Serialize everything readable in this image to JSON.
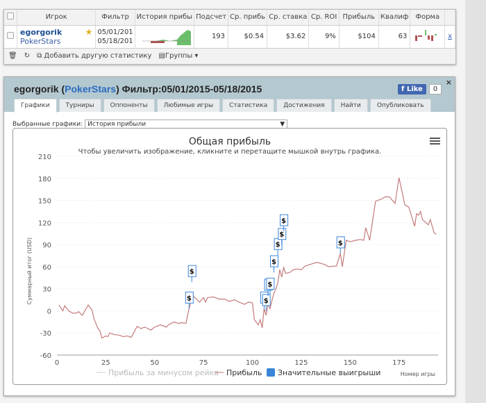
{
  "table": {
    "headers": [
      "Игрок",
      "Фильтр",
      "История прибы",
      "Подсчет",
      "Ср. прибь",
      "Ср. ставка",
      "Ср. ROI",
      "Прибыль",
      "Квалиф",
      "Форма"
    ],
    "row": {
      "player": "egorgorik",
      "site": "PokerStars",
      "filter_from": "05/01/201",
      "filter_to": "05/18/201",
      "count": "193",
      "avg_profit": "$0.54",
      "avg_stake": "$3.62",
      "avg_roi": "9%",
      "profit": "$104",
      "qual": "63",
      "remove": "x"
    },
    "footer": {
      "add_stat": "Добавить другую статистику",
      "groups": "Группы"
    }
  },
  "panel": {
    "player": "egorgorik",
    "site": "PokerStars",
    "filter": "Фильтр:05/01/2015-05/18/2015",
    "like": "Like",
    "like_count": "0",
    "close": "×",
    "tabs": [
      "Графики",
      "Турниры",
      "Оппоненты",
      "Любимые игры",
      "Статистика",
      "Достижения",
      "Найти",
      "Опубликовать"
    ],
    "active_tab": 0,
    "select_label": "Выбранные графики:",
    "select_value": "История прибыли"
  },
  "chart_data": {
    "type": "line",
    "title": "Общая прибыль",
    "subtitle": "Чтобы увеличить изображение, кликните и перетащите мышкой внутрь графика.",
    "ylabel": "Суммарный итог (USD)",
    "xlabel": "Номер игры",
    "ylim": [
      -60,
      210
    ],
    "yticks": [
      -60,
      -30,
      0,
      30,
      60,
      90,
      120,
      150,
      180,
      210
    ],
    "xlim": [
      0,
      195
    ],
    "xticks": [
      0,
      25,
      50,
      75,
      100,
      125,
      150,
      175
    ],
    "grid": true,
    "legend_placement": "bottom",
    "legend": [
      "Прибыль за минусом рейка",
      "Прибыль",
      "Значительные выигрыши"
    ],
    "colors": {
      "profit": "#c47a7a",
      "rake": "#cccccc",
      "flags": "#3a85d8"
    },
    "series": [
      {
        "name": "Прибыль",
        "points": [
          [
            1,
            8
          ],
          [
            3,
            0
          ],
          [
            4,
            7
          ],
          [
            6,
            0
          ],
          [
            8,
            -3
          ],
          [
            10,
            -3
          ],
          [
            11,
            -1
          ],
          [
            13,
            -6
          ],
          [
            16,
            8
          ],
          [
            18,
            1
          ],
          [
            19,
            -11
          ],
          [
            21,
            -24
          ],
          [
            22,
            -27
          ],
          [
            23,
            -37
          ],
          [
            25,
            -34
          ],
          [
            26,
            -35
          ],
          [
            27,
            -30
          ],
          [
            29,
            -32
          ],
          [
            32,
            -33
          ],
          [
            34,
            -35
          ],
          [
            36,
            -34
          ],
          [
            38,
            -36
          ],
          [
            41,
            -21
          ],
          [
            43,
            -24
          ],
          [
            45,
            -22
          ],
          [
            48,
            -26
          ],
          [
            50,
            -22
          ],
          [
            53,
            -19
          ],
          [
            56,
            -22
          ],
          [
            57,
            -19
          ],
          [
            60,
            -15
          ],
          [
            62,
            -17
          ],
          [
            64,
            -16
          ],
          [
            66,
            -17
          ],
          [
            67.6,
            3
          ],
          [
            68,
            7
          ],
          [
            69,
            22
          ],
          [
            73,
            12
          ],
          [
            75,
            18
          ],
          [
            76,
            12
          ],
          [
            77,
            18
          ],
          [
            80,
            19
          ],
          [
            83,
            16
          ],
          [
            86,
            16
          ],
          [
            88,
            13
          ],
          [
            91,
            15
          ],
          [
            93,
            12
          ],
          [
            96,
            9
          ],
          [
            98,
            12
          ],
          [
            100,
            11
          ],
          [
            101,
            -12
          ],
          [
            103,
            -19
          ],
          [
            104,
            -12
          ],
          [
            105,
            -23
          ],
          [
            106,
            3
          ],
          [
            107,
            -6
          ],
          [
            108,
            9
          ],
          [
            109,
            3
          ],
          [
            110,
            14
          ],
          [
            111,
            24
          ],
          [
            112,
            30
          ],
          [
            113,
            38
          ],
          [
            114,
            56
          ],
          [
            115,
            46
          ],
          [
            116,
            59
          ],
          [
            117,
            51
          ],
          [
            119,
            52
          ],
          [
            121,
            56
          ],
          [
            123,
            57
          ],
          [
            125,
            56
          ],
          [
            127,
            61
          ],
          [
            133,
            66
          ],
          [
            137,
            63
          ],
          [
            139,
            60
          ],
          [
            143,
            61
          ],
          [
            145,
            78
          ],
          [
            146,
            60
          ],
          [
            148,
            96
          ],
          [
            150,
            94
          ],
          [
            153,
            96
          ],
          [
            155,
            97
          ],
          [
            157,
            96
          ],
          [
            158,
            113
          ],
          [
            160,
            96
          ],
          [
            163,
            149
          ],
          [
            166,
            152
          ],
          [
            168,
            155
          ],
          [
            170,
            155
          ],
          [
            173,
            146
          ],
          [
            175,
            181
          ],
          [
            178,
            144
          ],
          [
            180,
            141
          ],
          [
            183,
            115
          ],
          [
            184,
            132
          ],
          [
            185,
            130
          ],
          [
            186,
            135
          ],
          [
            187,
            124
          ],
          [
            190,
            117
          ],
          [
            191,
            124
          ],
          [
            193,
            106
          ],
          [
            194,
            104
          ]
        ]
      }
    ],
    "flags": {
      "label": "$",
      "x": [
        67.6,
        69,
        106,
        107,
        108,
        109,
        111,
        113,
        115,
        116,
        145
      ]
    }
  }
}
